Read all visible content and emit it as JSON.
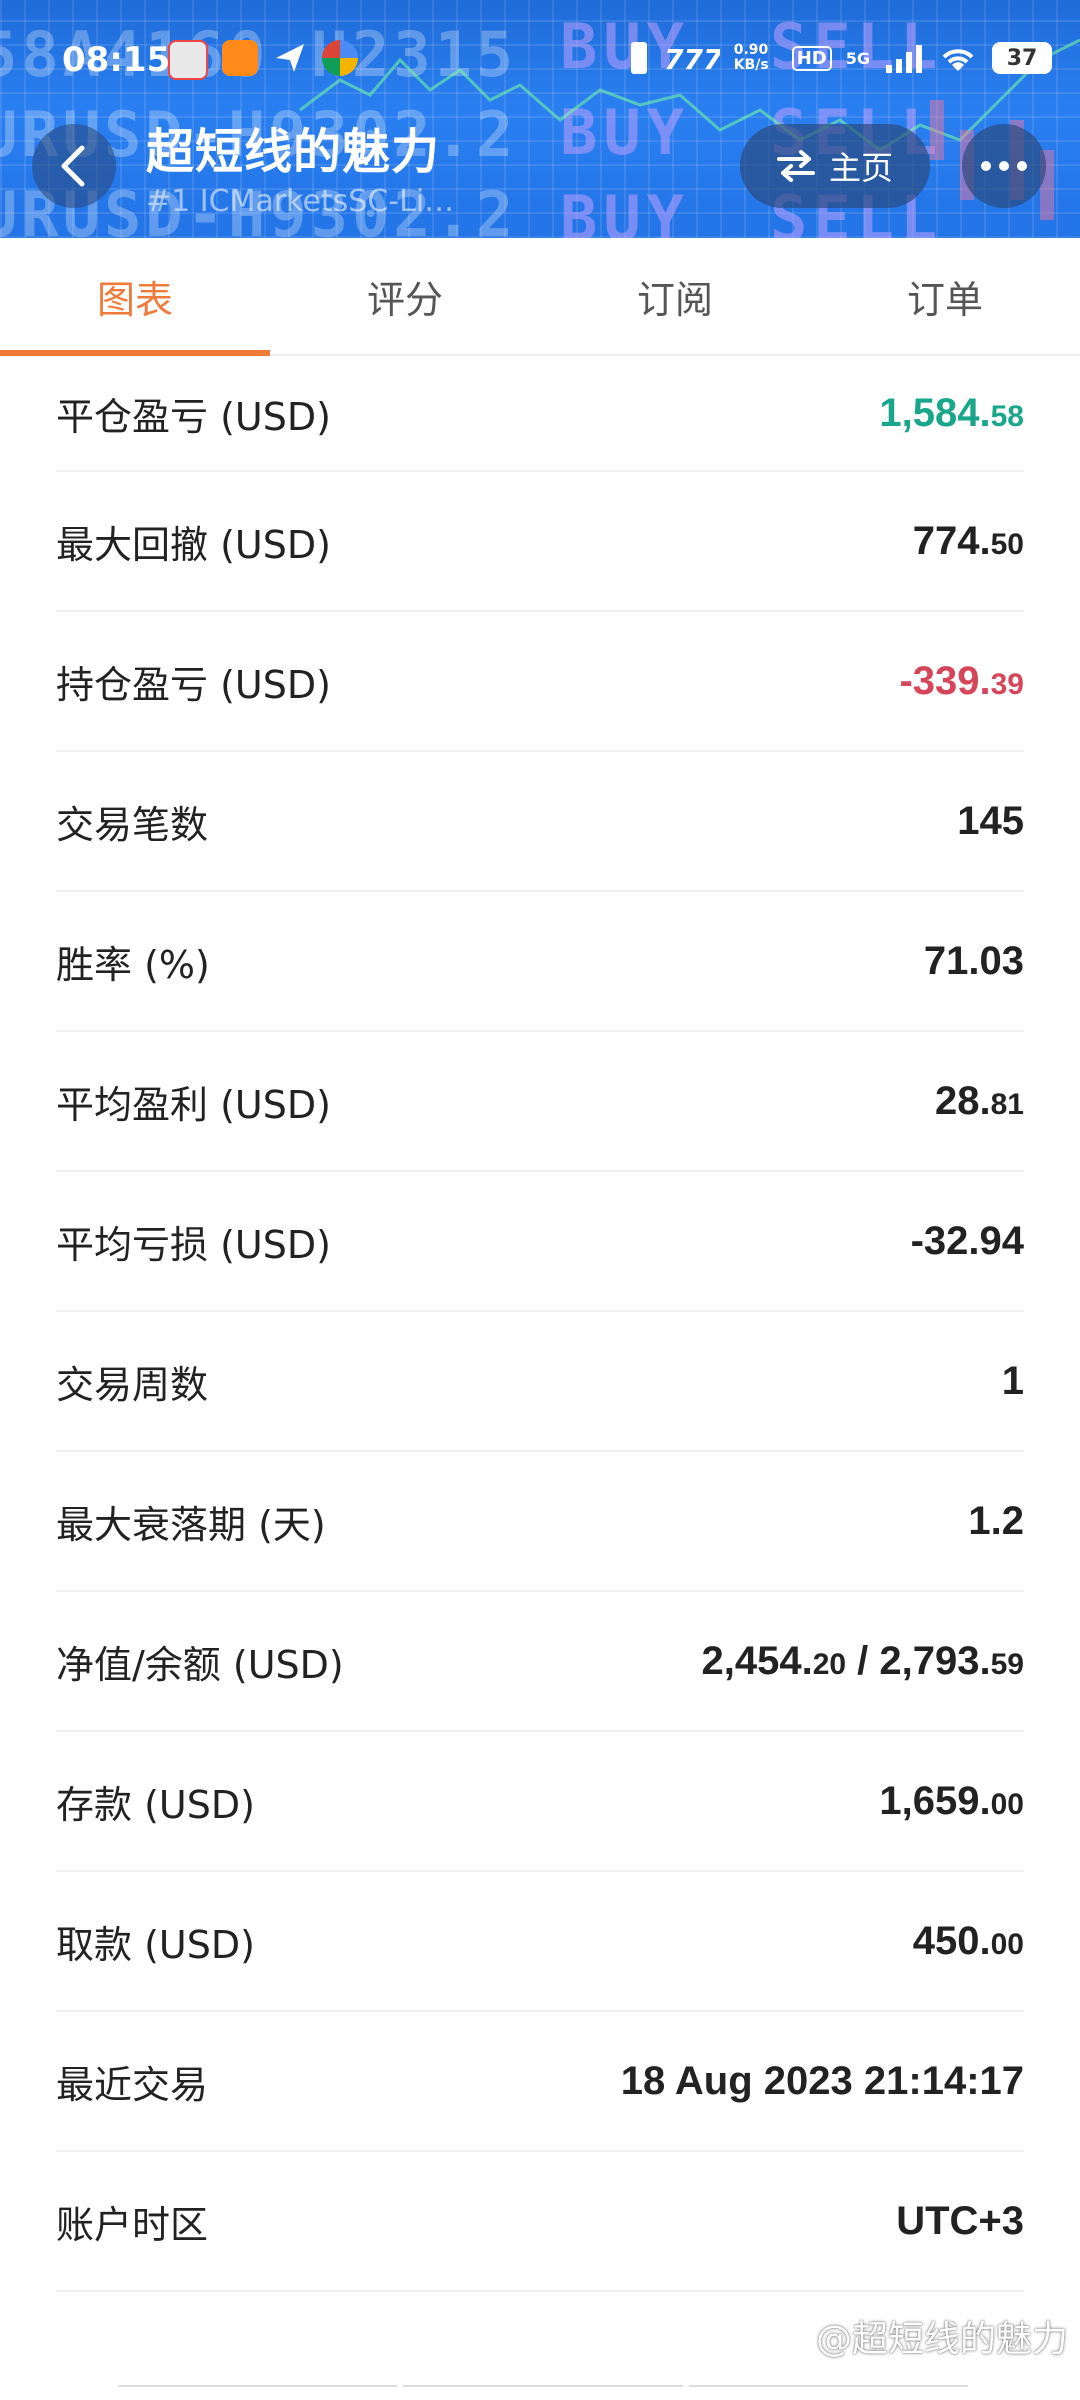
{
  "status_bar": {
    "time": "08:15",
    "net_speed": "0.90 KB/s",
    "hd": "HD",
    "signal": "5G",
    "battery": "37"
  },
  "header": {
    "title": "超短线的魅力",
    "subtitle": "#1  ICMarketsSC-Li…",
    "home_label": "主页"
  },
  "tabs": [
    "图表",
    "评分",
    "订阅",
    "订单"
  ],
  "active_tab": 0,
  "stats": [
    {
      "label": "平仓盈亏 (USD)",
      "int": "1,584.",
      "dec": "58",
      "color": "green"
    },
    {
      "label": "最大回撤 (USD)",
      "int": "774.",
      "dec": "50",
      "color": ""
    },
    {
      "label": "持仓盈亏 (USD)",
      "int": "-339.",
      "dec": "39",
      "color": "red"
    },
    {
      "label": "交易笔数",
      "int": "145",
      "dec": "",
      "color": ""
    },
    {
      "label": "胜率 (%)",
      "int": "71.03",
      "dec": "",
      "color": ""
    },
    {
      "label": "平均盈利 (USD)",
      "int": "28.",
      "dec": "81",
      "color": ""
    },
    {
      "label": "平均亏损 (USD)",
      "int": "-32.94",
      "dec": "",
      "color": ""
    },
    {
      "label": "交易周数",
      "int": "1",
      "dec": "",
      "color": ""
    },
    {
      "label": "最大衰落期 (天)",
      "int": "1.2",
      "dec": "",
      "color": ""
    },
    {
      "label": "净值/余额 (USD)",
      "int": "2,454.",
      "dec": "20",
      "int2": " / 2,793.",
      "dec2": "59",
      "color": ""
    },
    {
      "label": "存款 (USD)",
      "int": "1,659.",
      "dec": "00",
      "color": ""
    },
    {
      "label": "取款 (USD)",
      "int": "450.",
      "dec": "00",
      "color": ""
    },
    {
      "label": "最近交易",
      "int": "18 Aug 2023 21:14:17",
      "dec": "",
      "color": ""
    },
    {
      "label": "账户时区",
      "int": "UTC+3",
      "dec": "",
      "color": ""
    }
  ],
  "watermark": "@超短线的魅力",
  "colors": {
    "accent": "#f07a3a",
    "profit": "#1aa68a",
    "loss": "#d6465a"
  }
}
